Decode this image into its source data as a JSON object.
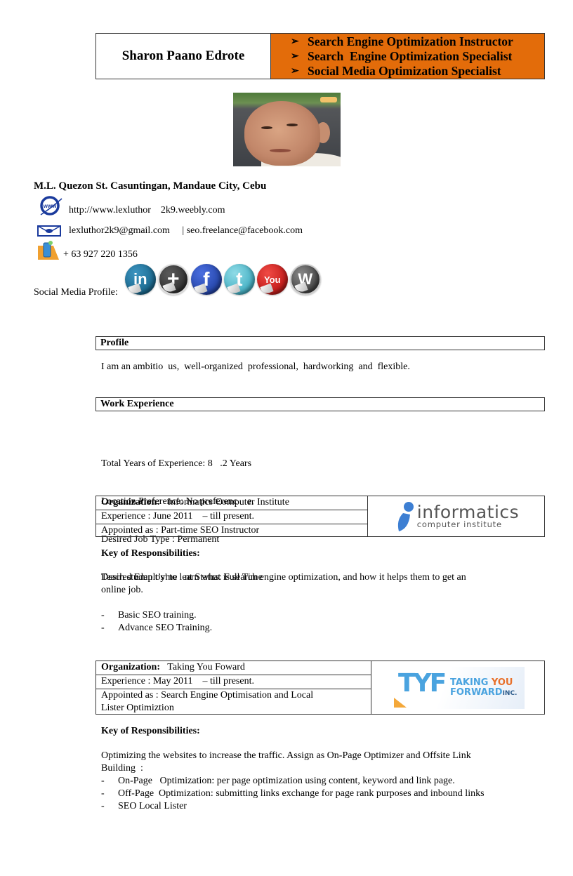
{
  "header": {
    "name": "Sharon Paano Edrote",
    "titles": [
      "Search Engine Optimization Instructor",
      "Search  Engine Optimization Specialist",
      "Social Media Optimization Specialist"
    ],
    "bullet_glyph": "➢",
    "accent_color": "#e36c0a"
  },
  "contact": {
    "address": "M.L. Quezon St. Casuntingan, Mandaue City, Cebu",
    "website": "http://www.lexluthor    2k9.weebly.com",
    "email": "lexluthor2k9@gmail.com     | seo.freelance@facebook.com",
    "phone": "+ 63 927 220 1356",
    "website_icon": "www-globe-icon",
    "email_icon": "envelope-icon",
    "phone_icon": "mobile-phone-icon"
  },
  "social": {
    "label": "Social Media Profile:",
    "icons": [
      {
        "name": "linkedin",
        "glyph": "in",
        "color": "#1f6e94"
      },
      {
        "name": "google-plus",
        "glyph": "+",
        "color": "#3a3a3a"
      },
      {
        "name": "facebook",
        "glyph": "f",
        "color": "#2a4bb0"
      },
      {
        "name": "twitter",
        "glyph": "t",
        "color": "#4fb6c9"
      },
      {
        "name": "youtube",
        "glyph": "You",
        "color": "#c8211f"
      },
      {
        "name": "wordpress",
        "glyph": "W",
        "color": "#555555"
      }
    ]
  },
  "profile": {
    "heading": "Profile",
    "text": "I am an ambitio  us,  well-organized  professional,  hardworking  and  flexible."
  },
  "work": {
    "heading": "Work Experience",
    "summary": [
      "Total Years of Experience: 8   .2 Years",
      "Location Preference: No preferenc    e.",
      "Desired Job Type : Permanent",
      "Desired Employme   nt Status: Full Time"
    ],
    "organizations": [
      {
        "org_label": "Organization:",
        "org_name": "Informatics Computer Institute",
        "experience": "Experience : June 2011    – till present.",
        "appointed": "Appointed as : Part-time SEO Instructor",
        "logo_text_main": "informatics",
        "logo_text_sub": "computer institute",
        "resp_title": "Key of Responsibilities:",
        "resp_text": "Teach studen t’s’ to learn what is search engine optimization, and how it helps them to get an\nonline job.",
        "bullets": [
          "Basic SEO training.",
          "Advance SEO Training."
        ]
      },
      {
        "org_label": "Organization:",
        "org_name": "Taking You Foward",
        "experience": "Experience : May 2011    – till present.",
        "appointed": "Appointed as : Search Engine Optimisation and Local\nLister Optimiztion",
        "logo_text_main": "TYF",
        "logo_text_taking": "TAKING",
        "logo_text_you": "YOU",
        "logo_text_forward": "FORWARD",
        "logo_text_inc": "INC.",
        "resp_title": "Key of Responsibilities:",
        "resp_text": "Optimizing the websites to increase the traffic. Assign as On-Page Optimizer and Offsite Link\nBuilding  :",
        "bullets": [
          "On-Page   Optimization: per page optimization using content, keyword and link page.",
          "Off-Page  Optimization: submitting links exchange for page rank purposes and inbound links",
          "SEO Local Lister"
        ]
      }
    ],
    "bullet_dash": "-"
  }
}
